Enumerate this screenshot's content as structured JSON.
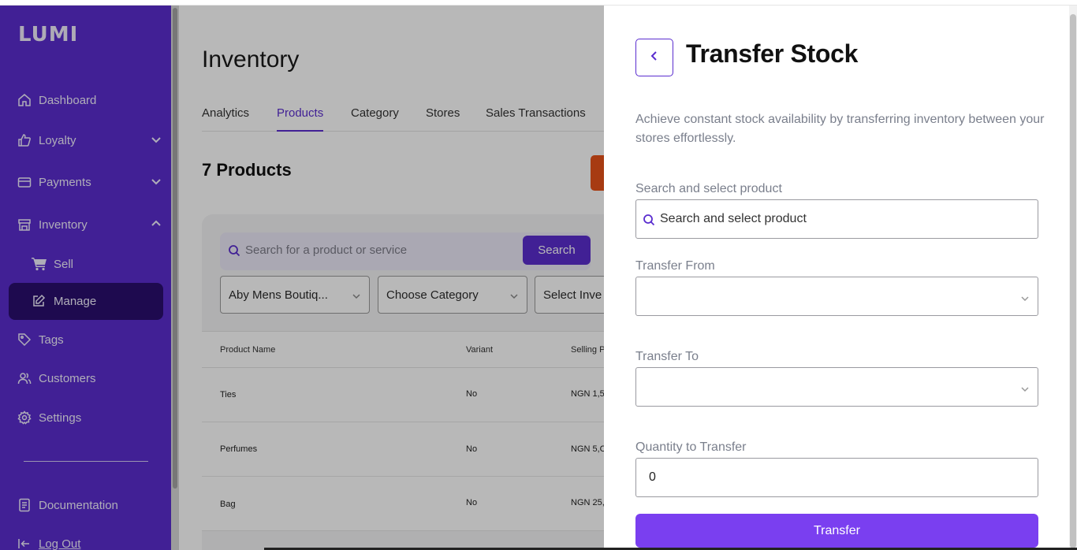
{
  "brand": {
    "logo": "LUMI",
    "accent": "#5a2dcf",
    "sidebar_active": "#2a0f6e",
    "button": "#7a3ff0",
    "orange": "#e8521a"
  },
  "sidebar": {
    "items": [
      {
        "label": "Dashboard",
        "icon": "home-icon"
      },
      {
        "label": "Loyalty",
        "icon": "thumbs-up-icon",
        "expandable": true
      },
      {
        "label": "Payments",
        "icon": "card-icon",
        "expandable": true
      },
      {
        "label": "Inventory",
        "icon": "store-icon",
        "expanded": true
      },
      {
        "label": "Sell",
        "icon": "cart-icon",
        "sub": true
      },
      {
        "label": "Manage",
        "icon": "edit-icon",
        "sub": true,
        "active": true
      },
      {
        "label": "Tags",
        "icon": "tag-icon"
      },
      {
        "label": "Customers",
        "icon": "users-icon"
      },
      {
        "label": "Settings",
        "icon": "gear-icon"
      },
      {
        "label": "Documentation",
        "icon": "document-icon"
      },
      {
        "label": "Log Out",
        "icon": "logout-icon"
      }
    ]
  },
  "main": {
    "title": "Inventory",
    "tabs": [
      {
        "label": "Analytics"
      },
      {
        "label": "Products",
        "active": true
      },
      {
        "label": "Category"
      },
      {
        "label": "Stores"
      },
      {
        "label": "Sales Transactions"
      }
    ],
    "count_label": "7 Products",
    "search": {
      "placeholder": "Search for a product or service",
      "button": "Search"
    },
    "filters": [
      "Aby Mens Boutiq...",
      "Choose Category",
      "Select Inve"
    ],
    "table": {
      "columns": [
        "Product Name",
        "Variant",
        "Selling P"
      ],
      "rows": [
        [
          "Ties",
          "No",
          "NGN 1,5("
        ],
        [
          "Perfumes",
          "No",
          "NGN 5,C"
        ],
        [
          "Bag",
          "No",
          "NGN 25,"
        ]
      ]
    }
  },
  "panel": {
    "title": "Transfer Stock",
    "description": "Achieve constant stock availability by transferring inventory between your stores effortlessly.",
    "product_label": "Search and select product",
    "product_placeholder": "Search and select product",
    "from_label": "Transfer From",
    "from_value": "",
    "to_label": "Transfer To",
    "to_value": "",
    "qty_label": "Quantity to Transfer",
    "qty_value": "0",
    "submit": "Transfer"
  }
}
